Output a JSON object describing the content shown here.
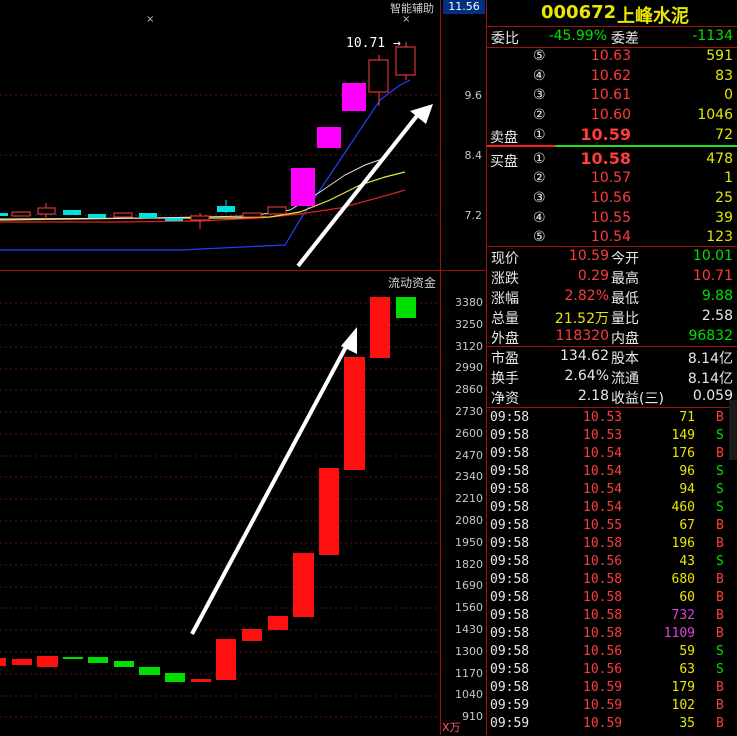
{
  "kline": {
    "top_label": "智能辅助",
    "price_now": "11.56",
    "high_label": "10.71",
    "high_arrow": "→",
    "scale": [
      "9.6",
      "8.4",
      "7.2"
    ],
    "marks": [
      "×",
      "×"
    ]
  },
  "flow": {
    "title": "流动资金",
    "unit": "X万",
    "scale": [
      "3380",
      "3250",
      "3120",
      "2990",
      "2860",
      "2730",
      "2600",
      "2470",
      "2340",
      "2210",
      "2080",
      "1950",
      "1820",
      "1690",
      "1560",
      "1430",
      "1300",
      "1170",
      "1040",
      "910"
    ]
  },
  "stock": {
    "code": "000672",
    "name": "上峰水泥"
  },
  "commission": {
    "ratio_label": "委比",
    "ratio": "-45.99%",
    "diff_label": "委差",
    "diff": "-1134"
  },
  "sell": [
    {
      "idx": "⑤",
      "price": "10.63",
      "vol": "591"
    },
    {
      "idx": "④",
      "price": "10.62",
      "vol": "83"
    },
    {
      "idx": "③",
      "price": "10.61",
      "vol": "0"
    },
    {
      "idx": "②",
      "price": "10.60",
      "vol": "1046"
    },
    {
      "idx": "①",
      "price": "10.59",
      "vol": "72",
      "label": "卖盘"
    }
  ],
  "buy": [
    {
      "idx": "①",
      "price": "10.58",
      "vol": "478",
      "label": "买盘"
    },
    {
      "idx": "②",
      "price": "10.57",
      "vol": "1"
    },
    {
      "idx": "③",
      "price": "10.56",
      "vol": "25"
    },
    {
      "idx": "④",
      "price": "10.55",
      "vol": "39"
    },
    {
      "idx": "⑤",
      "price": "10.54",
      "vol": "123"
    }
  ],
  "stats": [
    {
      "l1": "现价",
      "v1": "10.59",
      "c1": "red",
      "l2": "今开",
      "v2": "10.01",
      "c2": "green"
    },
    {
      "l1": "涨跌",
      "v1": "0.29",
      "c1": "red",
      "l2": "最高",
      "v2": "10.71",
      "c2": "red"
    },
    {
      "l1": "涨幅",
      "v1": "2.82%",
      "c1": "red",
      "l2": "最低",
      "v2": "9.88",
      "c2": "green"
    },
    {
      "l1": "总量",
      "v1": "21.52万",
      "c1": "yellow",
      "l2": "量比",
      "v2": "2.58",
      "c2": "white"
    },
    {
      "l1": "外盘",
      "v1": "118320",
      "c1": "red",
      "l2": "内盘",
      "v2": "96832",
      "c2": "green"
    }
  ],
  "fund": [
    {
      "l1": "市盈",
      "v1": "134.62",
      "l2": "股本",
      "v2": "8.14亿"
    },
    {
      "l1": "换手",
      "v1": "2.64%",
      "l2": "流通",
      "v2": "8.14亿"
    },
    {
      "l1": "净资",
      "v1": "2.18",
      "l2": "收益(三)",
      "v2": "0.059"
    }
  ],
  "ticks": [
    {
      "time": "09:58",
      "price": "10.53",
      "vol": "71",
      "side": "B"
    },
    {
      "time": "09:58",
      "price": "10.53",
      "vol": "149",
      "side": "S"
    },
    {
      "time": "09:58",
      "price": "10.54",
      "vol": "176",
      "side": "B"
    },
    {
      "time": "09:58",
      "price": "10.54",
      "vol": "96",
      "side": "S"
    },
    {
      "time": "09:58",
      "price": "10.54",
      "vol": "94",
      "side": "S"
    },
    {
      "time": "09:58",
      "price": "10.54",
      "vol": "460",
      "side": "S"
    },
    {
      "time": "09:58",
      "price": "10.55",
      "vol": "67",
      "side": "B"
    },
    {
      "time": "09:58",
      "price": "10.58",
      "vol": "196",
      "side": "B"
    },
    {
      "time": "09:58",
      "price": "10.56",
      "vol": "43",
      "side": "S"
    },
    {
      "time": "09:58",
      "price": "10.58",
      "vol": "680",
      "side": "B"
    },
    {
      "time": "09:58",
      "price": "10.58",
      "vol": "60",
      "side": "B"
    },
    {
      "time": "09:58",
      "price": "10.58",
      "vol": "732",
      "side": "B",
      "hl": true
    },
    {
      "time": "09:58",
      "price": "10.58",
      "vol": "1109",
      "side": "B",
      "hl": true
    },
    {
      "time": "09:58",
      "price": "10.56",
      "vol": "59",
      "side": "S"
    },
    {
      "time": "09:58",
      "price": "10.56",
      "vol": "63",
      "side": "S"
    },
    {
      "time": "09:58",
      "price": "10.59",
      "vol": "179",
      "side": "B"
    },
    {
      "time": "09:59",
      "price": "10.59",
      "vol": "102",
      "side": "B"
    },
    {
      "time": "09:59",
      "price": "10.59",
      "vol": "35",
      "side": "B"
    }
  ]
}
